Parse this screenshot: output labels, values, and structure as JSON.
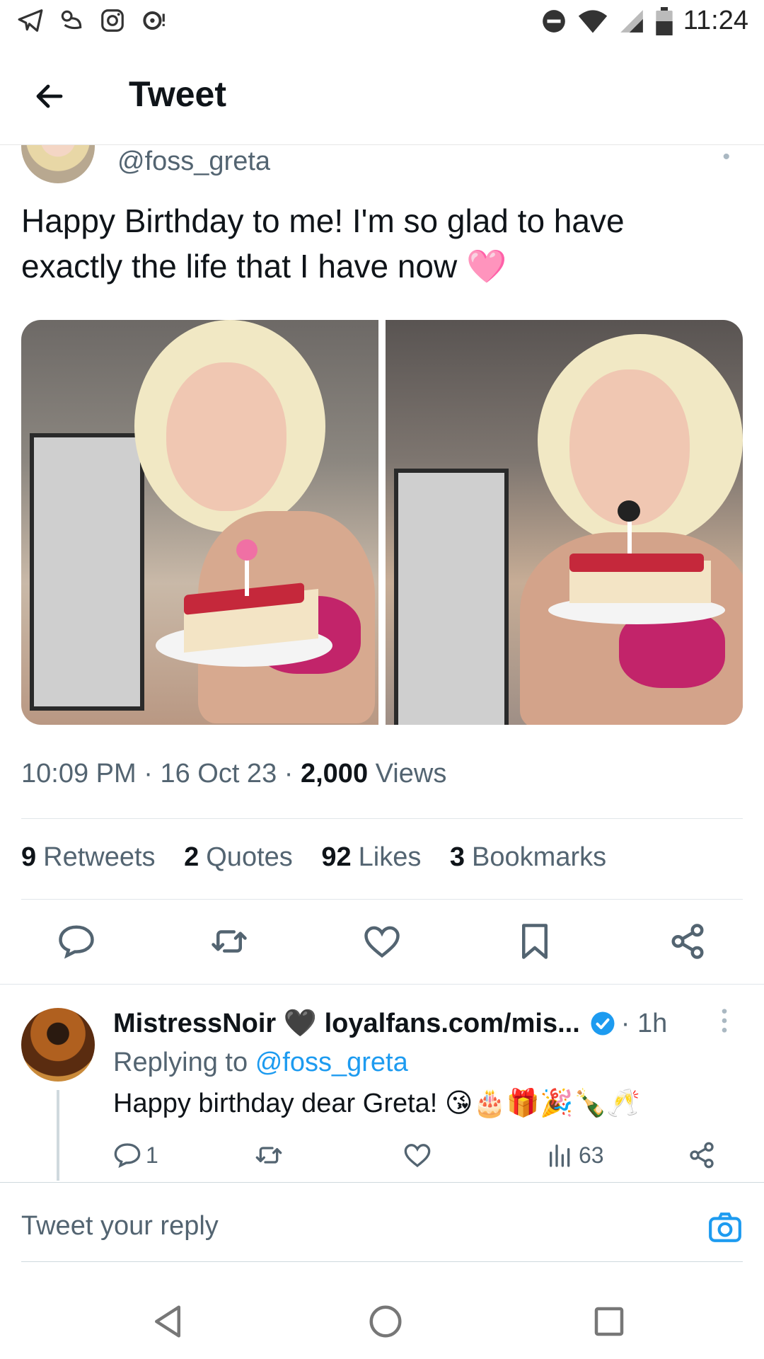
{
  "status_bar": {
    "time": "11:24",
    "left_icons": [
      "telegram-icon",
      "bird-app-icon",
      "instagram-icon",
      "chat-bubble-icon"
    ],
    "right_icons": [
      "do-not-disturb-icon",
      "wifi-icon",
      "cell-signal-icon",
      "battery-icon"
    ]
  },
  "header": {
    "title": "Tweet"
  },
  "tweet": {
    "handle": "@foss_greta",
    "text": "Happy Birthday to me! I'm so glad to have exactly the life that I have now 🩷",
    "time": "10:09 PM",
    "date": "16 Oct 23",
    "views_count": "2,000",
    "views_label": "Views",
    "stats": [
      {
        "count": "9",
        "label": "Retweets"
      },
      {
        "count": "2",
        "label": "Quotes"
      },
      {
        "count": "92",
        "label": "Likes"
      },
      {
        "count": "3",
        "label": "Bookmarks"
      }
    ]
  },
  "reply": {
    "name": "MistressNoir 🖤 loyalfans.com/mis...",
    "time": "· 1h",
    "replying_prefix": "Replying to",
    "replying_handle": "@foss_greta",
    "text": "Happy birthday dear Greta! 😘🎂🎁🎉🍾🥂",
    "reply_count": "1",
    "views_count": "63"
  },
  "compose": {
    "placeholder": "Tweet your reply"
  },
  "colors": {
    "accent": "#1d9bf0",
    "muted": "#536471",
    "text": "#0f1419"
  }
}
